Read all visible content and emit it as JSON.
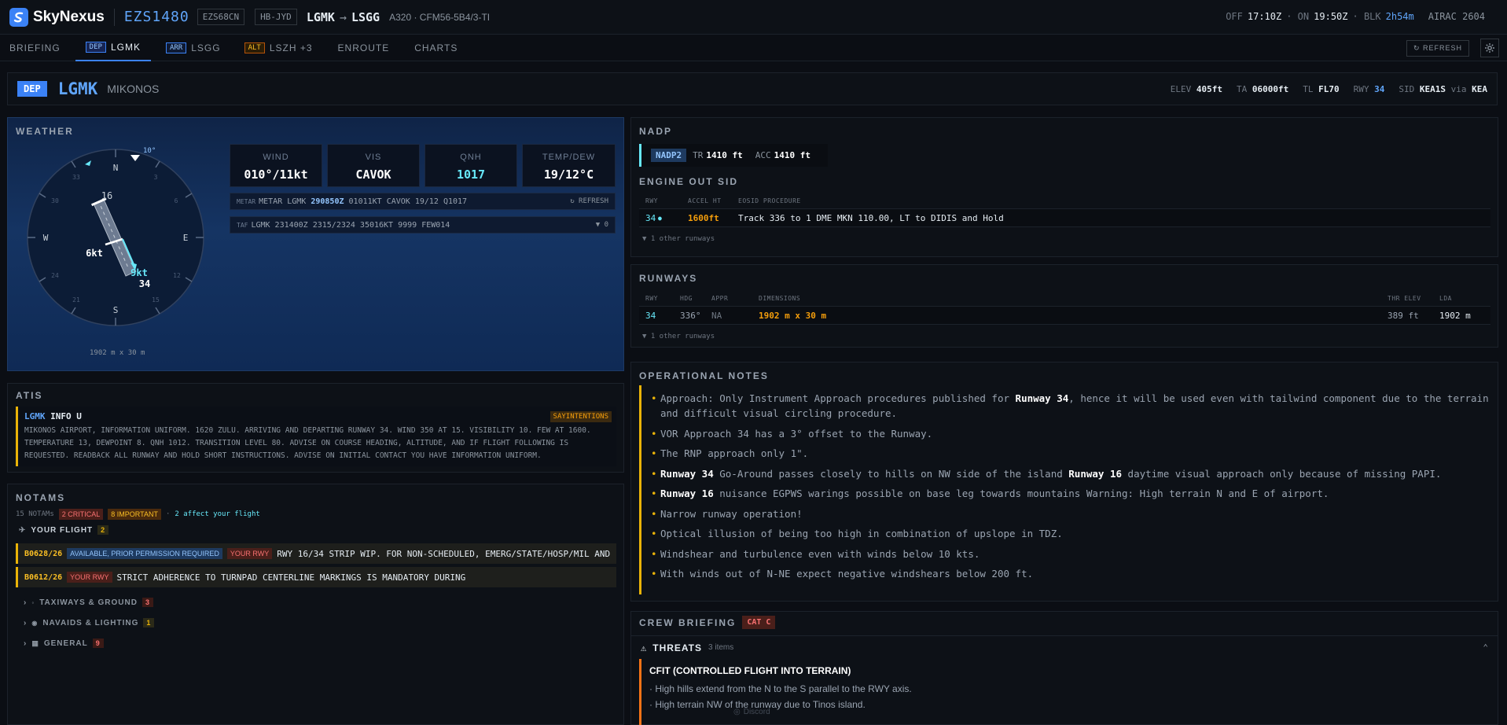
{
  "app": {
    "brand": "SkyNexus",
    "callsign": "EZS1480",
    "atc_callsign": "EZS68CN",
    "registration": "HB-JYD",
    "origin": "LGMK",
    "destination": "LSGG",
    "aircraft": "A320 · CFM56-5B4/3-TI"
  },
  "times": {
    "off_label": "OFF",
    "off": "17:10Z",
    "on_label": "· ON",
    "on": "19:50Z",
    "blk_label": "· BLK",
    "blk": "2h54m",
    "airac": "AIRAC 2604"
  },
  "tabs": [
    {
      "label": "BRIEFING",
      "tag": ""
    },
    {
      "label": "LGMK",
      "tag": "DEP"
    },
    {
      "label": "LSGG",
      "tag": "ARR"
    },
    {
      "label": "LSZH +3",
      "tag": "ALT"
    },
    {
      "label": "ENROUTE",
      "tag": ""
    },
    {
      "label": "CHARTS",
      "tag": ""
    }
  ],
  "toolbar": {
    "refresh": "↻ REFRESH"
  },
  "airport": {
    "badge": "DEP",
    "icao": "LGMK",
    "name": "MIKONOS",
    "elev_label": "ELEV",
    "elev": "405ft",
    "ta_label": "TA",
    "ta": "06000ft",
    "tl_label": "TL",
    "tl": "FL70",
    "rwy_label": "RWY",
    "rwy": "34",
    "sid_label": "SID",
    "sid": "KEA1S",
    "via_label": "via",
    "via": "KEA"
  },
  "weather": {
    "title": "WEATHER",
    "wind_dir_label": "10°",
    "compass": {
      "N": "N",
      "E": "E",
      "S": "S",
      "W": "W",
      "rwy_top": "16",
      "rwy_bot": "34",
      "xwind": "6kt",
      "hwind": "9kt",
      "dims": "1902 m x 30 m",
      "ticks": [
        "3",
        "6",
        "12",
        "15",
        "21",
        "24",
        "30",
        "33"
      ]
    },
    "boxes": [
      {
        "label": "WIND",
        "value": "010°/11kt"
      },
      {
        "label": "VIS",
        "value": "CAVOK"
      },
      {
        "label": "QNH",
        "value": "1017"
      },
      {
        "label": "TEMP/DEW",
        "value": "19/12°C"
      }
    ],
    "metar": {
      "prefix": "METAR",
      "text_a": "METAR LGMK",
      "time": "290850Z",
      "text_b": "01011KT CAVOK 19/12 Q1017",
      "action": "↻ REFRESH"
    },
    "taf": {
      "prefix": "TAF",
      "text": "LGMK 231400Z 2315/2324 35016KT 9999 FEW014",
      "count": "▼ 0"
    }
  },
  "atis": {
    "title": "ATIS",
    "icao": "LGMK",
    "info": "INFO U",
    "flag": "SAYINTENTIONS",
    "text": "MIKONOS AIRPORT, INFORMATION UNIFORM. 1620 ZULU. ARRIVING AND DEPARTING RUNWAY 34. WIND 350 AT 15. VISIBILITY 10. FEW AT 1600. TEMPERATURE 13, DEWPOINT 8. QNH 1012. TRANSITION LEVEL 80. ADVISE ON COURSE HEADING, ALTITUDE, AND IF FLIGHT FOLLOWING IS REQUESTED. READBACK ALL RUNWAY AND HOLD SHORT INSTRUCTIONS. ADVISE ON INITIAL CONTACT YOU HAVE INFORMATION UNIFORM."
  },
  "notams": {
    "title": "NOTAMS",
    "total": "15 NOTAMs",
    "critical": "2 CRITICAL",
    "important": "8 IMPORTANT",
    "affect": "2 affect your flight",
    "your_flight": "YOUR FLIGHT",
    "your_flight_count": "2",
    "items": [
      {
        "id": "B0628/26",
        "status": "AVAILABLE, PRIOR PERMISSION REQUIRED",
        "rwy": "YOUR RWY",
        "text": "RWY 16/34 STRIP WIP. FOR NON-SCHEDULED, EMERG/STATE/HOSP/MIL AND"
      },
      {
        "id": "B0612/26",
        "status": "",
        "rwy": "YOUR RWY",
        "text": "STRICT ADHERENCE TO TURNPAD CENTERLINE MARKINGS IS MANDATORY DURING"
      }
    ],
    "categories": [
      {
        "label": "TAXIWAYS & GROUND",
        "count": "3"
      },
      {
        "label": "NAVAIDS & LIGHTING",
        "count": "1"
      },
      {
        "label": "GENERAL",
        "count": "9"
      }
    ]
  },
  "nadp": {
    "title": "NADP",
    "name": "NADP2",
    "tr_label": "TR",
    "tr": "1410 ft",
    "acc_label": "ACC",
    "acc": "1410 ft",
    "eosid_title": "ENGINE OUT SID",
    "cols": [
      "RWY",
      "ACCEL HT",
      "EOSID PROCEDURE"
    ],
    "row": {
      "rwy": "34",
      "accel": "1600ft",
      "proc": "Track 336 to 1 DME MKN 110.00, LT to DIDIS and Hold"
    },
    "more": "▼ 1 other runways"
  },
  "runways": {
    "title": "RUNWAYS",
    "cols": [
      "RWY",
      "HDG",
      "APPR",
      "DIMENSIONS",
      "THR ELEV",
      "LDA"
    ],
    "row": {
      "rwy": "34",
      "hdg": "336°",
      "appr": "NA",
      "dims": "1902 m x 30 m",
      "thr": "389 ft",
      "lda": "1902 m"
    },
    "more": "▼ 1 other runways"
  },
  "ops": {
    "title": "OPERATIONAL NOTES",
    "n1a": "Approach: Only Instrument Approach procedures published for ",
    "n1b": "Runway 34",
    "n1c": ", hence it will be used even with tailwind component due to the terrain and difficult visual circling procedure.",
    "n2": "VOR Approach 34 has a 3° offset to the Runway.",
    "n3": "The RNP approach only 1\".",
    "n4a": "Runway 34",
    "n4b": " Go-Around passes closely to hills on NW side of the island ",
    "n4c": "Runway 16",
    "n4d": " daytime visual approach only because of missing PAPI.",
    "n5a": "Runway 16",
    "n5b": " nuisance EGPWS warings possible on base leg towards mountains Warning: High terrain N and E of airport.",
    "n6": "Narrow runway operation!",
    "n7": "Optical illusion of being too high in combination of upslope in TDZ.",
    "n8": "Windshear and turbulence even with winds below 10 kts.",
    "n9": "With winds out of N-NE expect negative windshears below 200 ft."
  },
  "crew": {
    "title": "CREW BRIEFING",
    "cat": "CAT C",
    "threats": "THREATS",
    "threats_count": "3 items",
    "threat_title": "CFIT (CONTROLLED FLIGHT INTO TERRAIN)",
    "bullets": [
      "High hills extend from the N to the S parallel to the RWY axis.",
      "High terrain NW of the runway due to Tinos island."
    ],
    "discord": "Discord"
  },
  "colors": {
    "accent": "#3b82f6",
    "warn": "#eab308",
    "cyan": "#67e8f9",
    "orange": "#f59e0b"
  }
}
